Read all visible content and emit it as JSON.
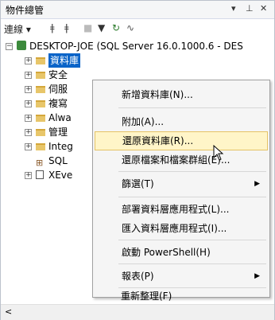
{
  "panel": {
    "title": "物件總管",
    "pin": "▾ ⊞ ✕"
  },
  "toolbar": {
    "connect": "連線 ▾"
  },
  "tree": {
    "server": "DESKTOP-JOE (SQL Server 16.0.1000.6 - DES",
    "items": [
      "資料庫",
      "安全",
      "伺服",
      "複寫",
      "Alwa",
      "管理",
      "Integ",
      "SQL",
      "XEve"
    ]
  },
  "menu": {
    "items": [
      "新增資料庫(N)...",
      "附加(A)...",
      "還原資料庫(R)...",
      "還原檔案和檔案群組(E)...",
      "篩選(T)",
      "部署資料層應用程式(L)...",
      "匯入資料層應用程式(I)...",
      "啟動 PowerShell(H)",
      "報表(P)",
      "重新整理(F)"
    ],
    "highlighted": "還原資料庫(R)..."
  }
}
